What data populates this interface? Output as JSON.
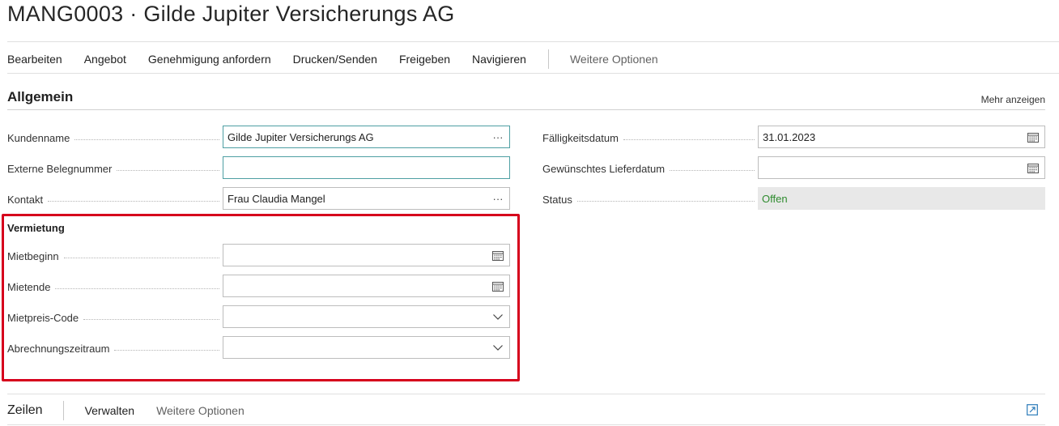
{
  "page": {
    "title": "MANG0003 · Gilde Jupiter Versicherungs AG"
  },
  "actions": {
    "items": [
      "Bearbeiten",
      "Angebot",
      "Genehmigung anfordern",
      "Drucken/Senden",
      "Freigeben",
      "Navigieren"
    ],
    "more": "Weitere Optionen"
  },
  "general": {
    "title": "Allgemein",
    "show_more": "Mehr anzeigen",
    "customer_name": {
      "label": "Kundenname",
      "value": "Gilde Jupiter Versicherungs AG"
    },
    "external_doc_no": {
      "label": "Externe Belegnummer",
      "value": ""
    },
    "contact": {
      "label": "Kontakt",
      "value": "Frau Claudia Mangel"
    },
    "due_date": {
      "label": "Fälligkeitsdatum",
      "value": "31.01.2023"
    },
    "requested_delivery": {
      "label": "Gewünschtes Lieferdatum",
      "value": ""
    },
    "status": {
      "label": "Status",
      "value": "Offen"
    }
  },
  "rental": {
    "title": "Vermietung",
    "start": {
      "label": "Mietbeginn",
      "value": ""
    },
    "end": {
      "label": "Mietende",
      "value": ""
    },
    "price_code": {
      "label": "Mietpreis-Code",
      "value": ""
    },
    "billing_period": {
      "label": "Abrechnungszeitraum",
      "value": ""
    }
  },
  "lines": {
    "title": "Zeilen",
    "manage": "Verwalten",
    "more": "Weitere Optionen"
  },
  "colors": {
    "accent": "#4e9fa3",
    "highlight": "#d6001c",
    "status": "#2e8b2e"
  },
  "icons": {
    "lookup": "ellipsis-icon",
    "calendar": "calendar-icon",
    "dropdown": "chevron-down-icon",
    "expand": "expand-icon"
  }
}
